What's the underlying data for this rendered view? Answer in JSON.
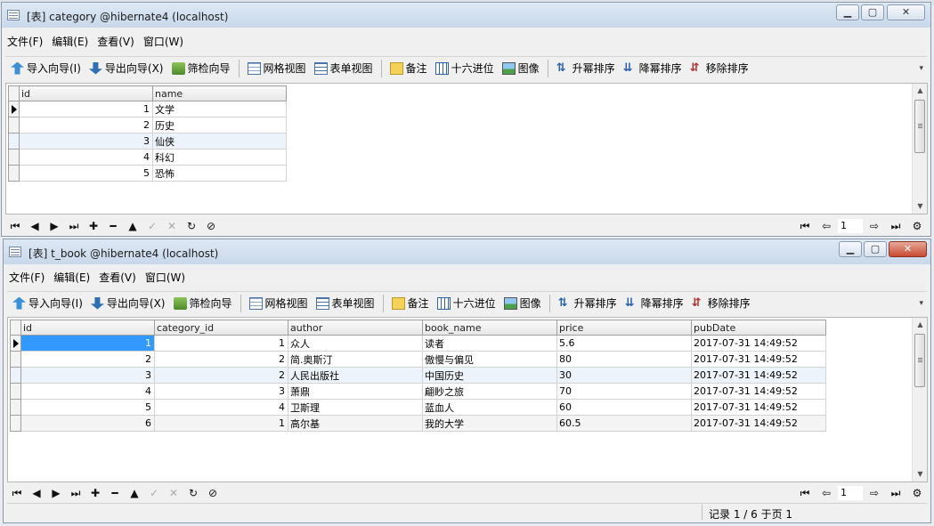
{
  "windows": [
    {
      "title": "[表] category @hibernate4 (localhost)",
      "menu": [
        "文件(F)",
        "编辑(E)",
        "查看(V)",
        "窗口(W)"
      ],
      "toolbar": {
        "import": "导入向导(I)",
        "export": "导出向导(X)",
        "filter": "筛检向导",
        "grid_view": "网格视图",
        "form_view": "表单视图",
        "memo": "备注",
        "hex": "十六进位",
        "image": "图像",
        "sort_asc": "升幂排序",
        "sort_desc": "降幂排序",
        "remove_sort": "移除排序"
      },
      "columns": [
        "id",
        "name"
      ],
      "rows": [
        [
          "1",
          "文学"
        ],
        [
          "2",
          "历史"
        ],
        [
          "3",
          "仙侠"
        ],
        [
          "4",
          "科幻"
        ],
        [
          "5",
          "恐怖"
        ]
      ],
      "page_value": "1"
    },
    {
      "title": "[表] t_book @hibernate4 (localhost)",
      "menu": [
        "文件(F)",
        "编辑(E)",
        "查看(V)",
        "窗口(W)"
      ],
      "toolbar": {
        "import": "导入向导(I)",
        "export": "导出向导(X)",
        "filter": "筛检向导",
        "grid_view": "网格视图",
        "form_view": "表单视图",
        "memo": "备注",
        "hex": "十六进位",
        "image": "图像",
        "sort_asc": "升幂排序",
        "sort_desc": "降幂排序",
        "remove_sort": "移除排序"
      },
      "columns": [
        "id",
        "category_id",
        "author",
        "book_name",
        "price",
        "pubDate"
      ],
      "rows": [
        [
          "1",
          "1",
          "众人",
          "读者",
          "5.6",
          "2017-07-31 14:49:52"
        ],
        [
          "2",
          "2",
          "简.奥斯汀",
          "傲慢与偏见",
          "80",
          "2017-07-31 14:49:52"
        ],
        [
          "3",
          "2",
          "人民出版社",
          "中国历史",
          "30",
          "2017-07-31 14:49:52"
        ],
        [
          "4",
          "3",
          "萧鼎",
          "翩眇之旅",
          "70",
          "2017-07-31 14:49:52"
        ],
        [
          "5",
          "4",
          "卫斯理",
          "蓝血人",
          "60",
          "2017-07-31 14:49:52"
        ],
        [
          "6",
          "1",
          "高尔基",
          "我的大学",
          "60.5",
          "2017-07-31 14:49:52"
        ]
      ],
      "page_value": "1",
      "status": "记录 1 / 6 于页 1"
    }
  ]
}
